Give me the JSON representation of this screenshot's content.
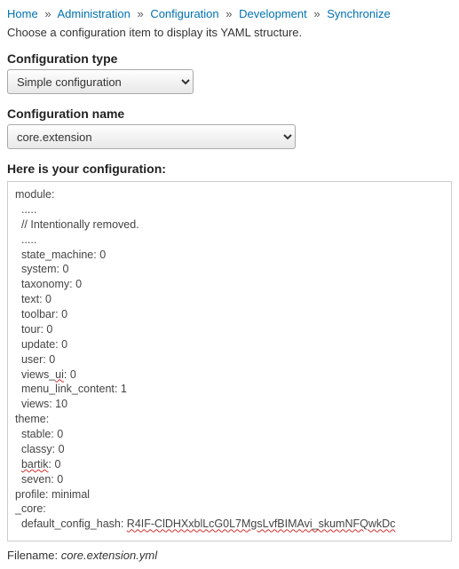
{
  "breadcrumb": {
    "items": [
      "Home",
      "Administration",
      "Configuration",
      "Development",
      "Synchronize"
    ],
    "sep": "»"
  },
  "intro": "Choose a configuration item to display its YAML structure.",
  "type_field": {
    "label": "Configuration type",
    "value": "Simple configuration"
  },
  "name_field": {
    "label": "Configuration name",
    "value": "core.extension"
  },
  "config_heading": "Here is your configuration:",
  "yaml": {
    "l01": "module:",
    "l02": "  .....",
    "l03": "  // Intentionally removed.",
    "l04": "  .....",
    "l05": "  state_machine: 0",
    "l06": "  system: 0",
    "l07": "  taxonomy: 0",
    "l08": "  text: 0",
    "l09": "  toolbar: 0",
    "l10": "  tour: 0",
    "l11": "  update: 0",
    "l12": "  user: 0",
    "l13a": "  views_",
    "l13b": "ui",
    "l13c": ": 0",
    "l14": "  menu_link_content: 1",
    "l15": "  views: 10",
    "l16": "theme:",
    "l17": "  stable: 0",
    "l18": "  classy: 0",
    "l19a": "  ",
    "l19b": "bartik",
    "l19c": ": 0",
    "l20": "  seven: 0",
    "l21": "profile: minimal",
    "l22": "_core:",
    "l23a": "  default_config_hash: ",
    "l23b": "R4IF-ClDHXxblLcG0L7MgsLvfBIMAvi_skumNFQwkDc"
  },
  "filename": {
    "label": "Filename: ",
    "value": "core.extension.yml"
  }
}
